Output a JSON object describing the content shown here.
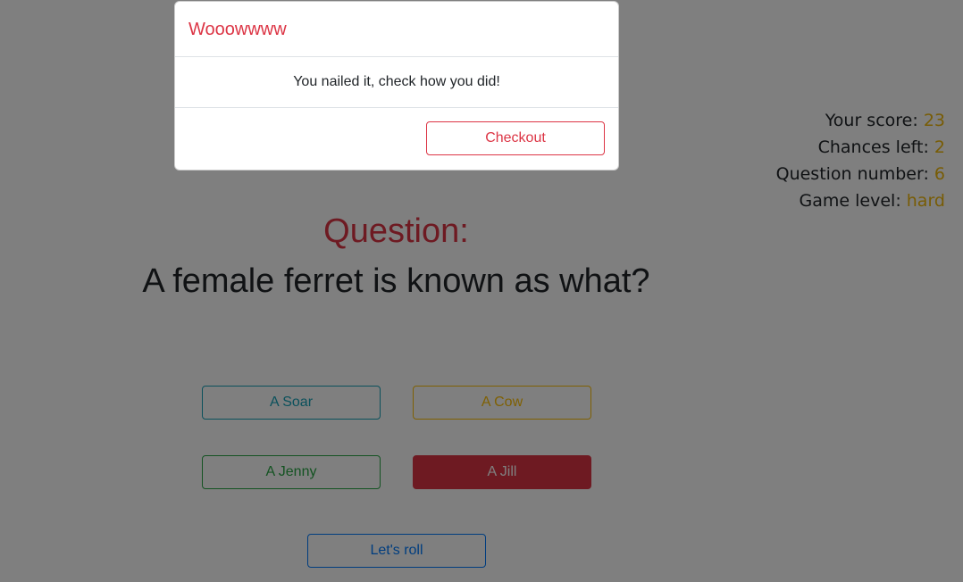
{
  "modal": {
    "title": "Wooowwww",
    "message": "You nailed it, check how you did!",
    "button": "Checkout"
  },
  "stats": {
    "score_label": "Your score:",
    "score_value": "23",
    "chances_label": "Chances left:",
    "chances_value": "2",
    "question_number_label": "Question number:",
    "question_number_value": "6",
    "level_label": "Game level:",
    "level_value": "hard"
  },
  "question": {
    "heading": "Question:",
    "text": "A female ferret is known as what?"
  },
  "answers": [
    {
      "label": "A Soar",
      "color": "#17a2b8"
    },
    {
      "label": "A Cow",
      "color": "#ffc107"
    },
    {
      "label": "A Jenny",
      "color": "#28a745"
    },
    {
      "label": "A Jill",
      "color": "#dc3545"
    }
  ],
  "roll_button": "Let's roll"
}
